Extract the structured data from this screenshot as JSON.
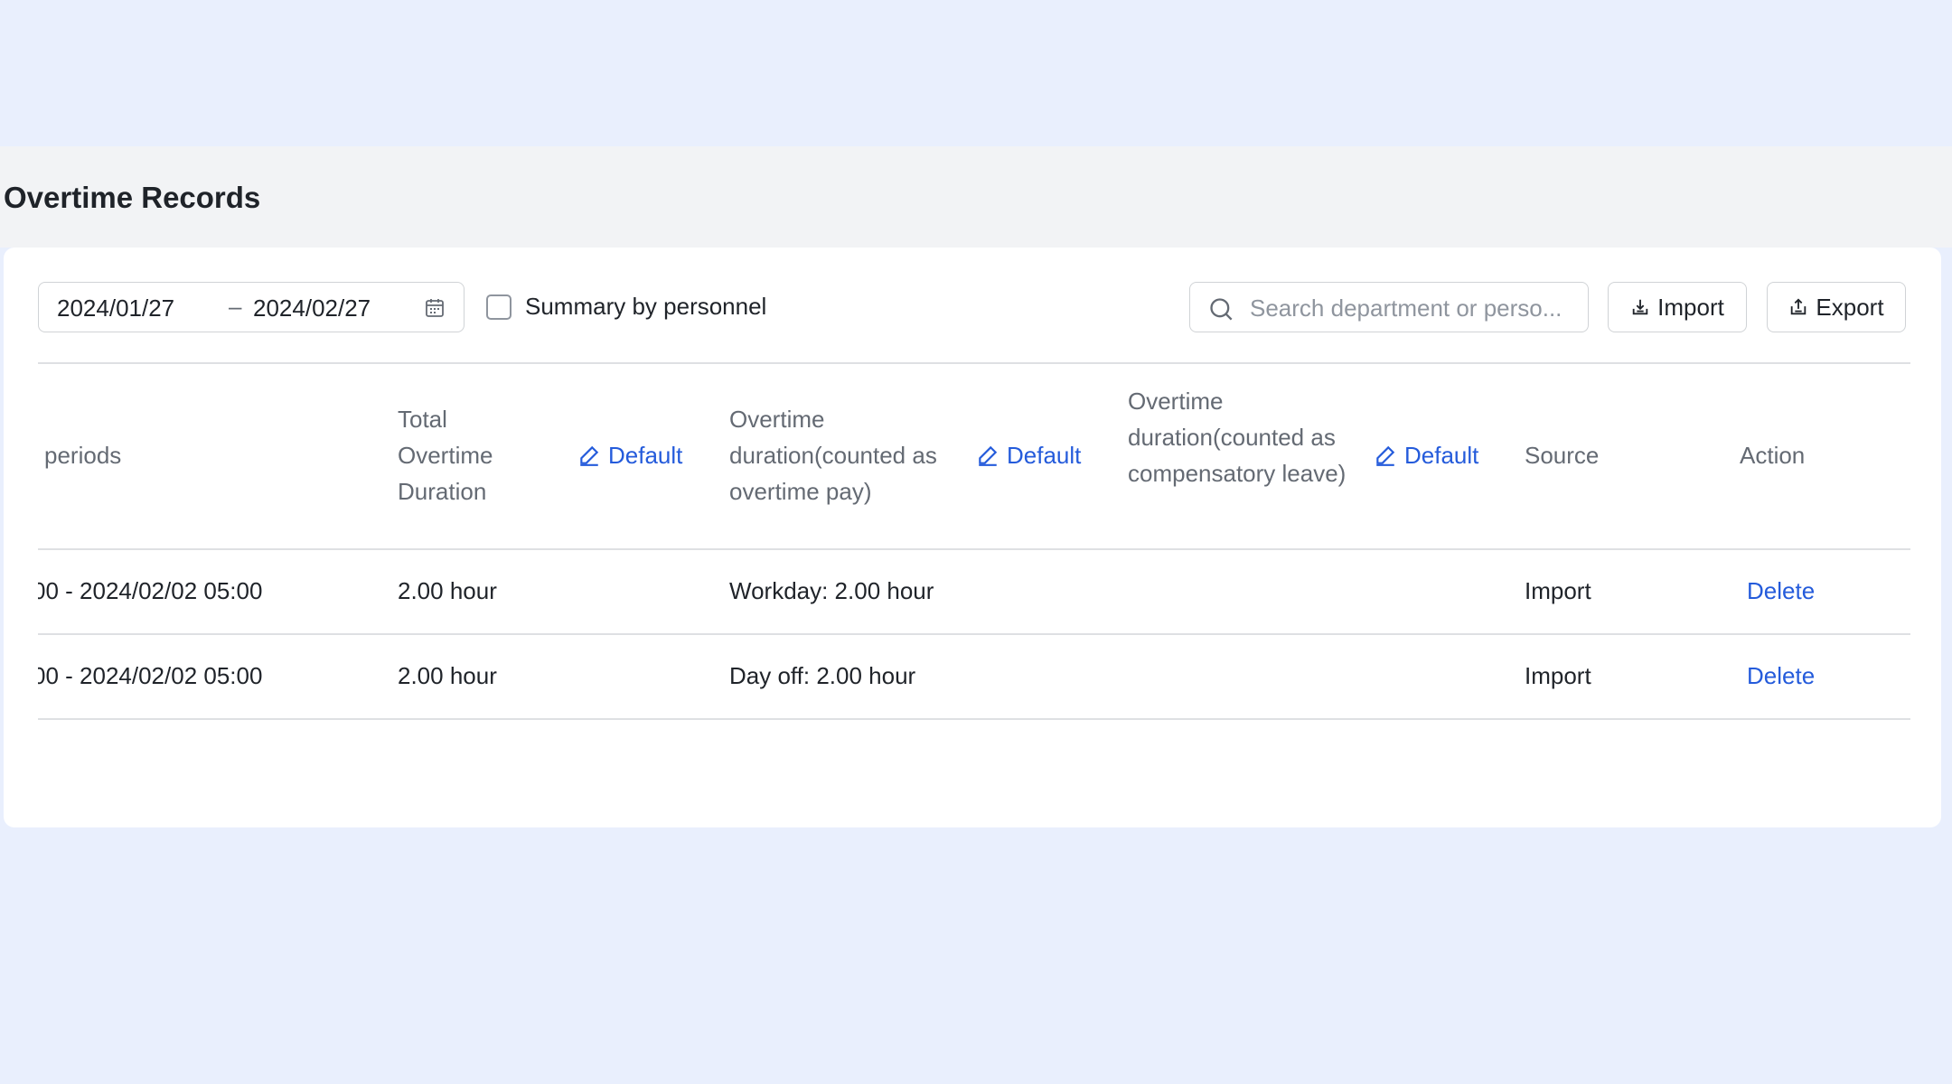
{
  "page": {
    "title": "Overtime Records"
  },
  "toolbar": {
    "date_start": "2024/01/27",
    "date_separator": "–",
    "date_end": "2024/02/27",
    "summary_checkbox_label": "Summary by personnel",
    "summary_checked": false,
    "search_placeholder": "Search department or perso...",
    "import_label": "Import",
    "export_label": "Export"
  },
  "table": {
    "headers": {
      "periods": "periods",
      "total": "Total Overtime Duration",
      "pay": "Overtime duration(counted as overtime pay)",
      "leave": "Overtime duration(counted as compensatory leave)",
      "source": "Source",
      "action": "Action",
      "default_label": "Default"
    },
    "rows": [
      {
        "period": "00 - 2024/02/02 05:00",
        "total": "2.00 hour",
        "pay": "Workday: 2.00 hour",
        "leave": "",
        "source": "Import",
        "action": "Delete"
      },
      {
        "period": "00 - 2024/02/02 05:00",
        "total": "2.00 hour",
        "pay": "Day off: 2.00 hour",
        "leave": "",
        "source": "Import",
        "action": "Delete"
      }
    ]
  },
  "colors": {
    "accent": "#245bdb",
    "background": "#e9effd",
    "text": "#1f2329",
    "muted_text": "#646a73",
    "border": "#dee0e3"
  },
  "icons": {
    "calendar": "calendar-icon",
    "search": "search-icon",
    "import": "import-icon",
    "export": "export-icon",
    "edit": "edit-icon"
  }
}
